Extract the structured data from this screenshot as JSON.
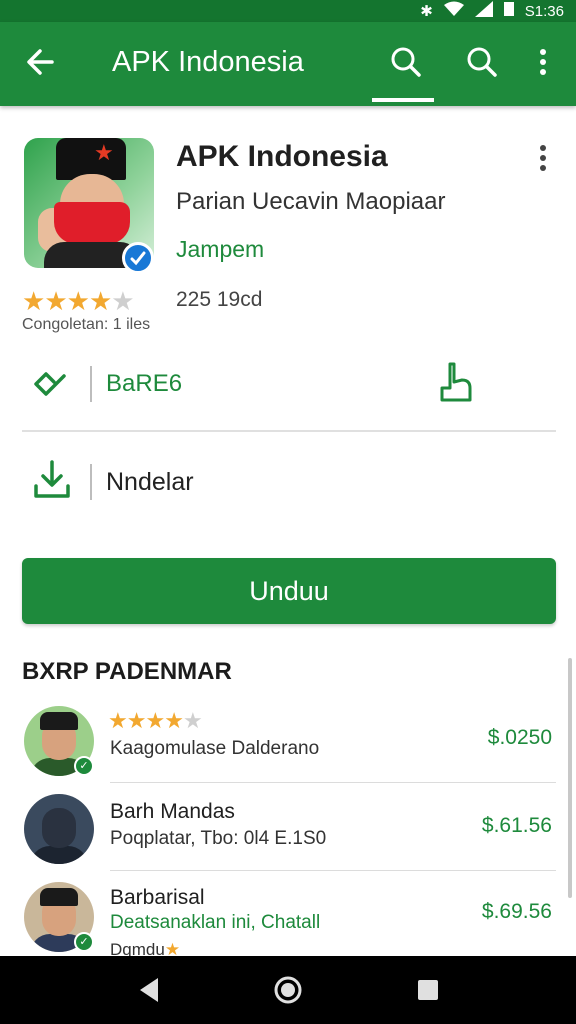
{
  "status_bar": {
    "time": "S1:36"
  },
  "app_bar": {
    "title": "APK Indonesia"
  },
  "app": {
    "title": "APK Indonesia",
    "subtitle": "Parian Uecavin Maopiaar",
    "developer": "Jampem",
    "rating": 3.5,
    "rating_label": "Congoletan: 1 iles",
    "rating_count": "225 19cd"
  },
  "actions": {
    "share_label": "BaRE6",
    "download_label": "Nndelar",
    "install_label": "Unduu"
  },
  "section": {
    "title": "BXRP PADENMAR"
  },
  "list": [
    {
      "name": "",
      "stars": 4,
      "sub": "Kaagomulase Dalderano",
      "price": "$.0250"
    },
    {
      "name": "Barh Mandas",
      "sub": "Poqplatar, Tbo: 0l4 E.1S0",
      "price": "$.61.56"
    },
    {
      "name": "Barbarisal",
      "sub": "Deatsanaklan ini, Chatall",
      "sub2": "Dqmdu",
      "price": "$.69.56"
    }
  ],
  "colors": {
    "primary": "#1e8a3c",
    "status_bar": "#14752f",
    "star": "#f2a830"
  }
}
